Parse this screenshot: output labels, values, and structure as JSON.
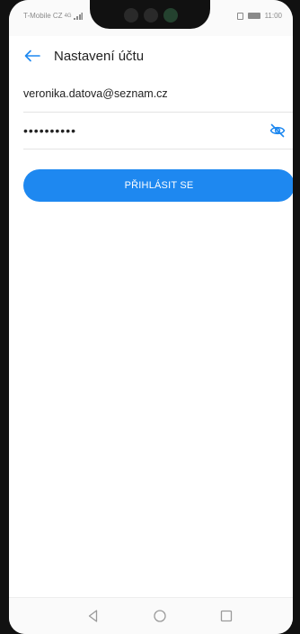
{
  "status_bar": {
    "carrier": "T-Mobile CZ",
    "network": "4G",
    "time": "11:00"
  },
  "app_bar": {
    "title": "Nastavení účtu",
    "back_icon": "arrow-left-icon"
  },
  "form": {
    "email": {
      "value": "veronika.datova@seznam.cz",
      "placeholder": ""
    },
    "password": {
      "value": "••••••••••",
      "toggle_icon": "eye-off-icon"
    },
    "login_label": "PŘIHLÁSIT SE"
  },
  "nav_bar": {
    "back_icon": "triangle-back-icon",
    "home_icon": "circle-home-icon",
    "recents_icon": "square-recents-icon"
  },
  "colors": {
    "accent": "#1e88f0",
    "text": "#222222",
    "divider": "#e4e4e4"
  }
}
